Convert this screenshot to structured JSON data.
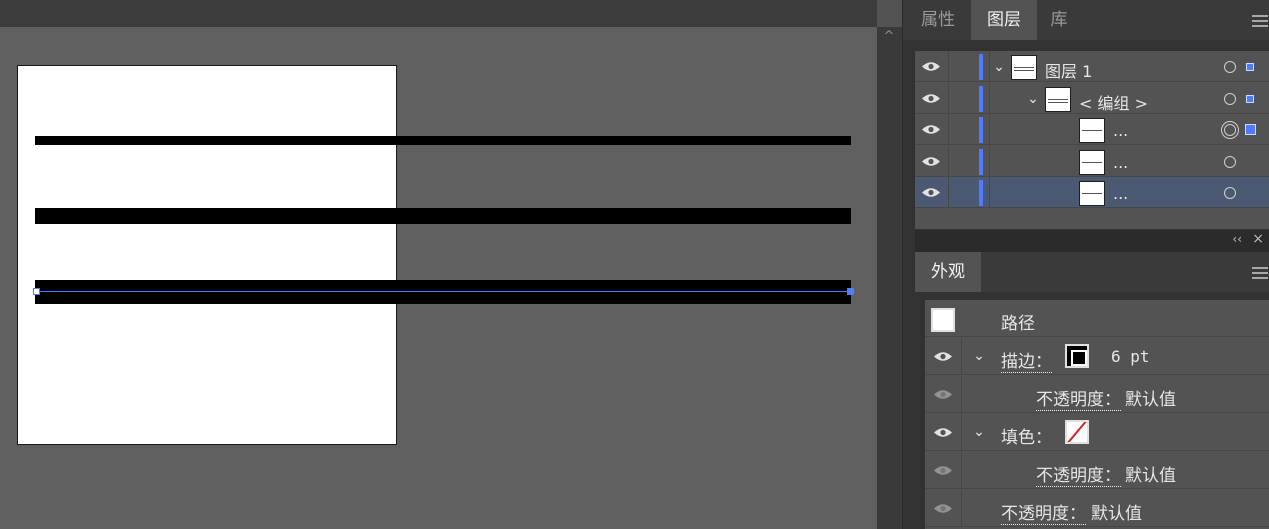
{
  "panels": {
    "tabs": [
      "属性",
      "图层",
      "库"
    ],
    "active_tab": "图层"
  },
  "layers": {
    "rows": [
      {
        "name": "图层 1",
        "expanded": true,
        "selected": false,
        "target": "single",
        "selection_square": "small"
      },
      {
        "name": "< 编组 >",
        "expanded": true,
        "selected": false,
        "target": "single",
        "selection_square": "small"
      },
      {
        "name": "...",
        "expanded": false,
        "selected": false,
        "target": "double",
        "selection_square": "large"
      },
      {
        "name": "...",
        "expanded": false,
        "selected": false,
        "target": "single",
        "selection_square": "none"
      },
      {
        "name": "...",
        "expanded": false,
        "selected": true,
        "target": "single",
        "selection_square": "none"
      }
    ],
    "layer_color": "#4f7cff"
  },
  "appearance": {
    "tab": "外观",
    "object_type": "路径",
    "stroke_label": "描边：",
    "stroke_value": "6 pt",
    "stroke_opacity_label": "不透明度：",
    "stroke_opacity_value": "默认值",
    "fill_label": "填色：",
    "fill_opacity_label": "不透明度：",
    "fill_opacity_value": "默认值",
    "opacity_label": "不透明度：",
    "opacity_value": "默认值"
  },
  "canvas": {
    "artboard_color": "#ffffff",
    "selection_color": "#4f7cff",
    "scroll_up_glyph": "^"
  },
  "icons": {
    "eye": "eye-icon",
    "chevron": "chevron-down-icon",
    "menu": "panel-menu-icon",
    "collapse": "double-chevron-left-icon",
    "close": "close-icon"
  }
}
